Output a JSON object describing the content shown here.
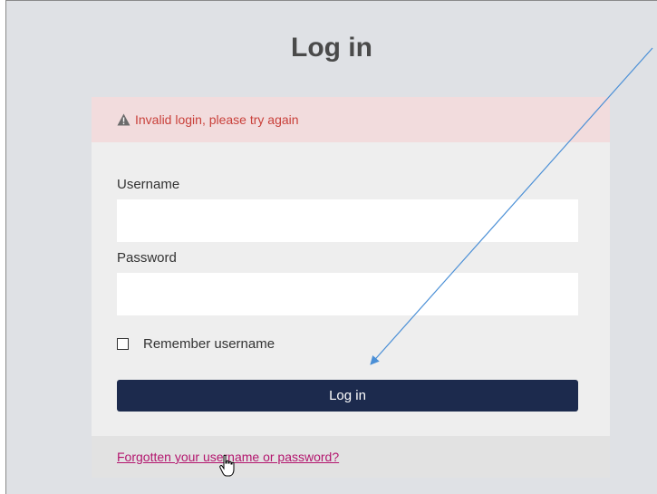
{
  "page": {
    "title": "Log in"
  },
  "alert": {
    "icon": "warning-triangle-icon",
    "message": "Invalid login, please try again",
    "color": "#c9403a",
    "background": "#f2dcdd"
  },
  "form": {
    "username_label": "Username",
    "username_value": "",
    "password_label": "Password",
    "password_value": "",
    "remember_label": "Remember username",
    "remember_checked": false,
    "submit_label": "Log in",
    "submit_color": "#1c2a4d"
  },
  "footer": {
    "forgot_link": "Forgotten your username or password?",
    "link_color": "#b3166e"
  },
  "annotation": {
    "arrow_color": "#4a8fd6",
    "cursor": "hand-pointer-icon"
  }
}
